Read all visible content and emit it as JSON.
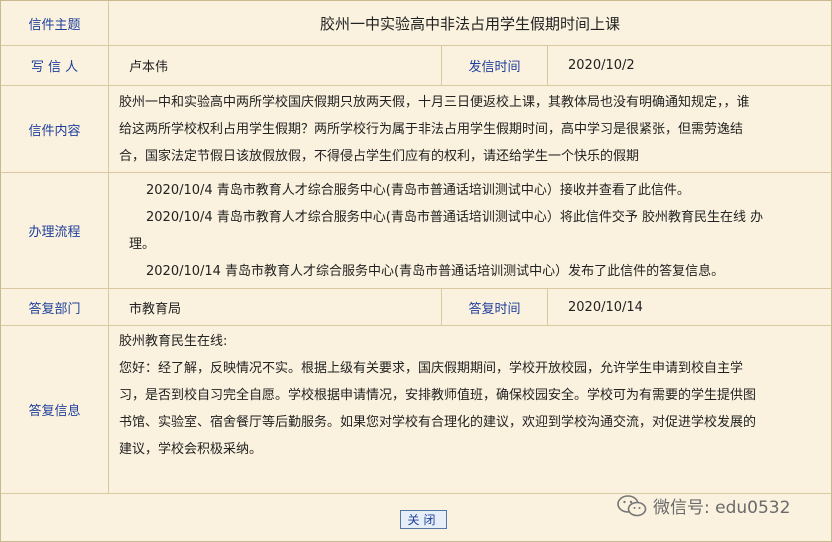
{
  "subject": {
    "label": "信件主题",
    "value": "胶州一中实验高中非法占用学生假期时间上课"
  },
  "writer": {
    "label": "写 信 人",
    "value": "卢本伟",
    "time_label": "发信时间",
    "time_value": "2020/10/2"
  },
  "content": {
    "label": "信件内容",
    "lines": [
      "胶州一中和实验高中两所学校国庆假期只放两天假，十月三日便返校上课，其教体局也没有明确通知规定，，谁",
      "给这两所学校权利占用学生假期？两所学校行为属于非法占用学生假期时间，高中学习是很紧张，但需劳逸结",
      "合，国家法定节假日该放假放假，不得侵占学生们应有的权利，请还给学生一个快乐的假期"
    ]
  },
  "process": {
    "label": "办理流程",
    "lines": [
      "2020/10/4  青岛市教育人才综合服务中心(青岛市普通话培训测试中心）接收并查看了此信件。",
      "2020/10/4  青岛市教育人才综合服务中心(青岛市普通话培训测试中心）将此信件交予 胶州教育民生在线  办",
      "理。",
      "2020/10/14  青岛市教育人才综合服务中心(青岛市普通话培训测试中心）发布了此信件的答复信息。"
    ]
  },
  "reply_dept": {
    "label": "答复部门",
    "value": "市教育局",
    "time_label": "答复时间",
    "time_value": "2020/10/14"
  },
  "reply": {
    "label": "答复信息",
    "lines": [
      "胶州教育民生在线:",
      "您好：经了解，反映情况不实。根据上级有关要求，国庆假期期间，学校开放校园，允许学生申请到校自主学",
      "习，是否到校自习完全自愿。学校根据申请情况，安排教师值班，确保校园安全。学校可为有需要的学生提供图",
      "书馆、实验室、宿舍餐厅等后勤服务。如果您对学校有合理化的建议，欢迎到学校沟通交流，对促进学校发展的",
      "建议，学校会积极采纳。"
    ]
  },
  "close_button": "关闭",
  "watermark": "微信号: edu0532"
}
